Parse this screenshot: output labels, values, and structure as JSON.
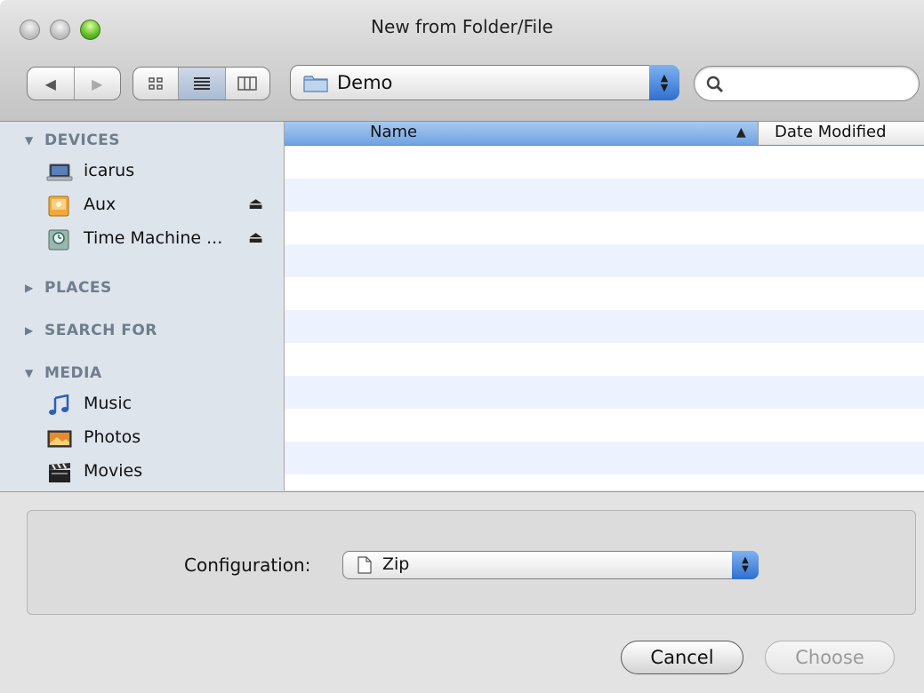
{
  "window": {
    "title": "New from Folder/File"
  },
  "toolbar": {
    "back_icon": "left-triangle-icon",
    "forward_icon": "right-triangle-icon",
    "view_modes": [
      "icon-view",
      "list-view",
      "column-view"
    ],
    "active_view": "list-view",
    "path": "Demo",
    "search_value": ""
  },
  "sidebar": {
    "sections": {
      "devices": "DEVICES",
      "places": "PLACES",
      "search_for": "SEARCH FOR",
      "media": "MEDIA"
    },
    "devices": [
      {
        "label": "icarus",
        "icon": "laptop-icon"
      },
      {
        "label": "Aux",
        "icon": "external-drive-icon"
      },
      {
        "label": "Time Machine ...",
        "icon": "time-machine-drive-icon"
      }
    ],
    "media": [
      {
        "label": "Music",
        "icon": "music-note-icon"
      },
      {
        "label": "Photos",
        "icon": "photos-icon"
      },
      {
        "label": "Movies",
        "icon": "movie-clapper-icon"
      }
    ]
  },
  "file_list": {
    "columns": [
      "Name",
      "Date Modified"
    ],
    "sort_column": "Name",
    "sort_direction": "ascending",
    "rows": []
  },
  "accessory": {
    "config_label": "Configuration:",
    "config_value": "Zip"
  },
  "buttons": {
    "cancel": "Cancel",
    "choose": "Choose"
  },
  "colors": {
    "accent": "#2e6fd0",
    "sidebar_bg": "#dde4ec",
    "header_selected": "#6fa3e2",
    "stripe": "#edf3fe"
  }
}
